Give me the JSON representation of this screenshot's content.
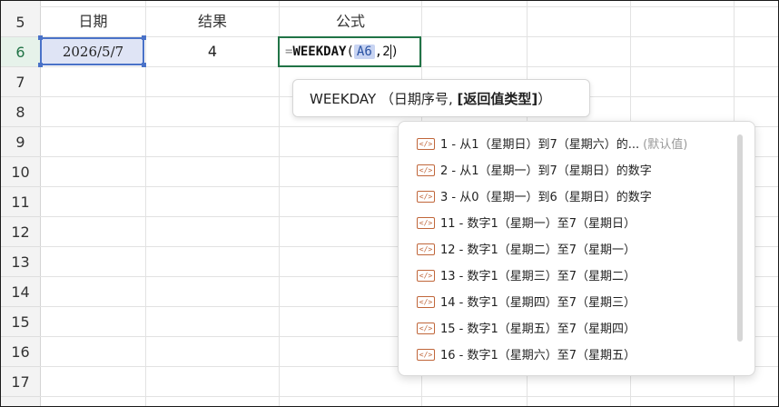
{
  "rows": [
    "5",
    "6",
    "7",
    "8",
    "9",
    "10",
    "11",
    "12",
    "13",
    "14",
    "15",
    "16",
    "17"
  ],
  "active_row": "6",
  "headers": {
    "date": "日期",
    "result": "结果",
    "formula": "公式"
  },
  "values": {
    "date": "2026/5/7",
    "result": "4"
  },
  "formula": {
    "eq": "=",
    "fn": "WEEKDAY",
    "open": "(",
    "ref": "A6",
    "sep": ",",
    "arg": "2",
    "close": ")"
  },
  "tooltip": {
    "pre": "WEEKDAY （日期序号, ",
    "bold": "[返回值类型]",
    "post": "）"
  },
  "icon_glyph": "</>",
  "options": [
    {
      "text": "1 - 从1（星期日）到7（星期六）的...",
      "note": "(默认值)"
    },
    {
      "text": "2 - 从1（星期一）到7（星期日）的数字",
      "note": ""
    },
    {
      "text": "3 - 从0（星期一）到6（星期日）的数字",
      "note": ""
    },
    {
      "text": "11 - 数字1（星期一）至7（星期日）",
      "note": ""
    },
    {
      "text": "12 - 数字1（星期二）至7（星期一）",
      "note": ""
    },
    {
      "text": "13 - 数字1（星期三）至7（星期二）",
      "note": ""
    },
    {
      "text": "14 - 数字1（星期四）至7（星期三）",
      "note": ""
    },
    {
      "text": "15 - 数字1（星期五）至7（星期四）",
      "note": ""
    },
    {
      "text": "16 - 数字1（星期六）至7（星期五）",
      "note": ""
    }
  ],
  "colors": {
    "selection_border": "#4a72c8",
    "edit_border": "#217346",
    "icon": "#c0663a"
  }
}
